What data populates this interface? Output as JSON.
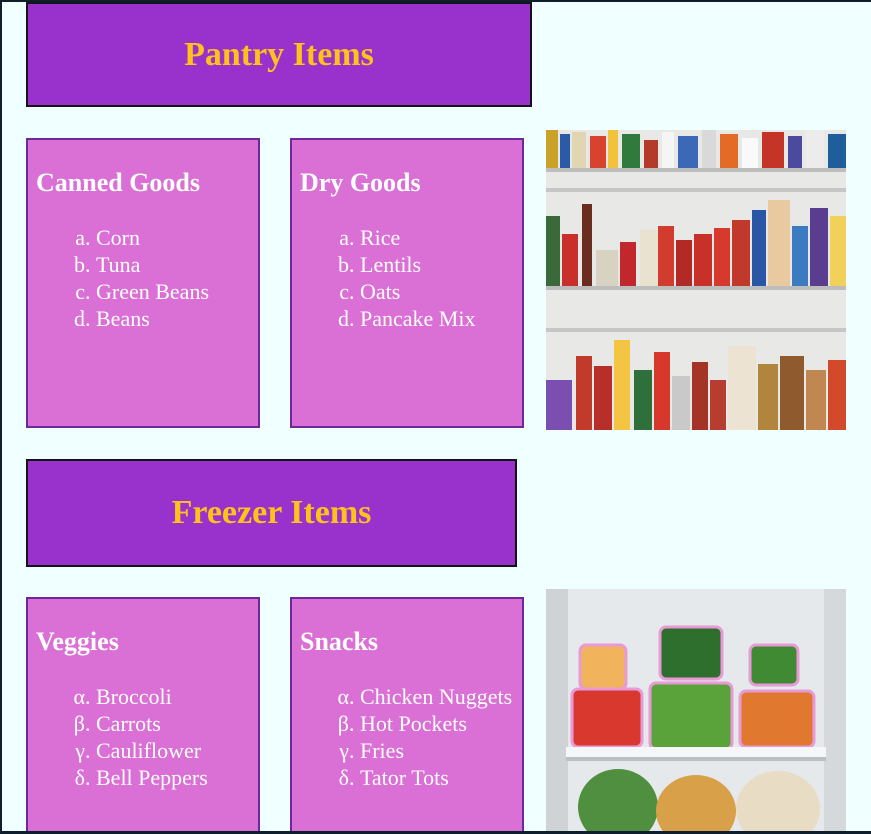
{
  "pantry": {
    "title": "Pantry Items",
    "canned": {
      "heading": "Canned Goods",
      "items": [
        "Corn",
        "Tuna",
        "Green Beans",
        "Beans"
      ]
    },
    "dry": {
      "heading": "Dry Goods",
      "items": [
        "Rice",
        "Lentils",
        "Oats",
        "Pancake Mix"
      ]
    },
    "photo_icon": "pantry-shelves-photo"
  },
  "freezer": {
    "title": "Freezer Items",
    "veggies": {
      "heading": "Veggies",
      "items": [
        "Broccoli",
        "Carrots",
        "Cauliflower",
        "Bell Peppers"
      ]
    },
    "snacks": {
      "heading": "Snacks",
      "items": [
        "Chicken Nuggets",
        "Hot Pockets",
        "Fries",
        "Tator Tots"
      ]
    },
    "photo_icon": "freezer-containers-photo"
  },
  "colors": {
    "banner": "#9932cc",
    "banner_text": "#ffc21a",
    "card": "#da70d6",
    "page": "#f0ffff"
  }
}
